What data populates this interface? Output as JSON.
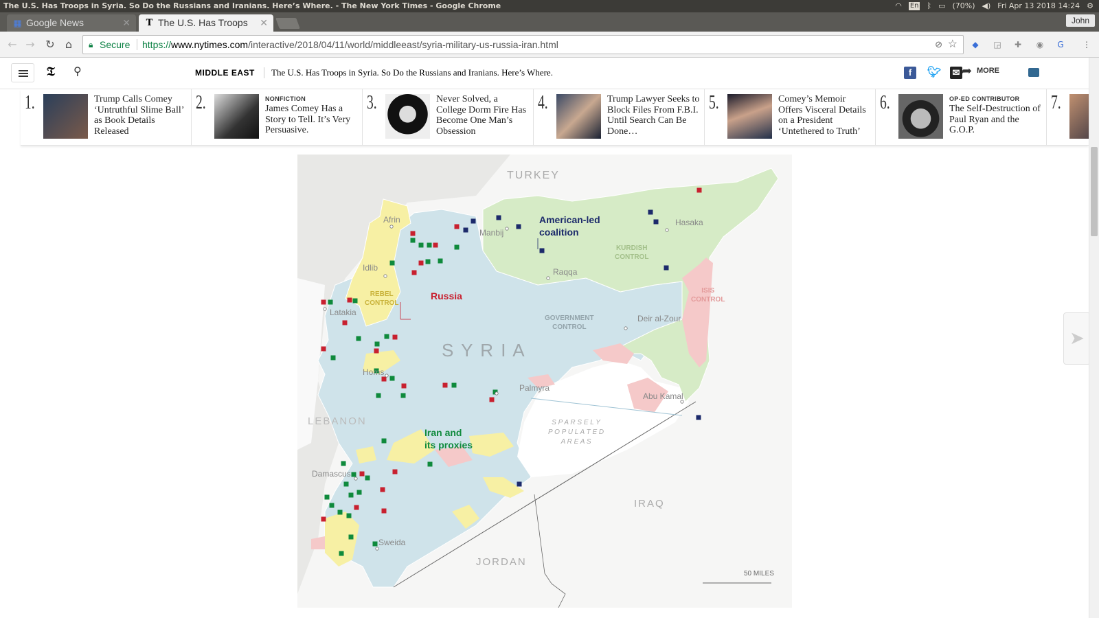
{
  "os": {
    "window_title": "The U.S. Has Troops in Syria. So Do the Russians and Iranians. Here’s Where. - The New York Times - Google Chrome",
    "lang": "En",
    "battery": "(70%)",
    "clock": "Fri Apr 13 2018 14:24"
  },
  "tabs": [
    {
      "label": "Google News",
      "icon": "google-news-icon"
    },
    {
      "label": "The U.S. Has Troops",
      "icon": "nyt-icon"
    }
  ],
  "user": "John",
  "toolbar": {
    "secure_label": "Secure",
    "url_scheme": "https://",
    "url_host": "www.nytimes.com",
    "url_path": "/interactive/2018/04/11/world/middleeast/syria-military-us-russia-iran.html"
  },
  "nyt": {
    "section": "MIDDLE EAST",
    "headline": "The U.S. Has Troops in Syria. So Do the Russians and Iranians. Here’s Where.",
    "more_label": "MORE"
  },
  "popular": [
    {
      "num": "1.",
      "kicker": "",
      "text": "Trump Calls Comey ‘Untruthful Slime Ball’ as Book Details Released"
    },
    {
      "num": "2.",
      "kicker": "NONFICTION",
      "text": "James Comey Has a Story to Tell. It’s Very Persuasive."
    },
    {
      "num": "3.",
      "kicker": "",
      "text": "Never Solved, a College Dorm Fire Has Become One Man’s Obsession"
    },
    {
      "num": "4.",
      "kicker": "",
      "text": "Trump Lawyer Seeks to Block Files From F.B.I. Until Search Can Be Done…"
    },
    {
      "num": "5.",
      "kicker": "",
      "text": "Comey’s Memoir Offers Visceral Details on a President ‘Untethered to Truth’"
    },
    {
      "num": "6.",
      "kicker": "OP-ED CONTRIBUTOR",
      "text": "The Self-Destruction of Paul Ryan and the G.O.P."
    },
    {
      "num": "7.",
      "kicker": "",
      "text": ""
    }
  ],
  "map": {
    "countries": {
      "turkey": "TURKEY",
      "syria": "S Y R I A",
      "lebanon": "LEBANON",
      "iraq": "IRAQ",
      "jordan": "JORDAN"
    },
    "cities": {
      "afrin": "Afrin",
      "manbij": "Manbij",
      "hasaka": "Hasaka",
      "idlib": "Idlib",
      "raqqa": "Raqqa",
      "latakia": "Latakia",
      "deir": "Deir al-Zour",
      "homs": "Homs",
      "palmyra": "Palmyra",
      "abukamal": "Abu Kamal",
      "damascus": "Damascus",
      "sweida": "Sweida"
    },
    "zones": {
      "kurdish": "KURDISH\nCONTROL",
      "isis": "ISIS\nCONTROL",
      "rebel": "REBEL\nCONTROL",
      "government": "GOVERNMENT\nCONTROL",
      "sparse": "S P A R S E L Y\nP O P U L A T E D\nA R E A S"
    },
    "forces": {
      "us": "American-led\ncoalition",
      "russia": "Russia",
      "iran": "Iran and\nits proxies"
    },
    "scale": "50 MILES",
    "colors": {
      "us": "#1c2a6b",
      "russia": "#c8202f",
      "iran": "#0f8a3c",
      "government": "#cfe3ea",
      "kurdish": "#d6ebc6",
      "rebel": "#f7f0a4",
      "isis": "#f5c9c9"
    }
  }
}
